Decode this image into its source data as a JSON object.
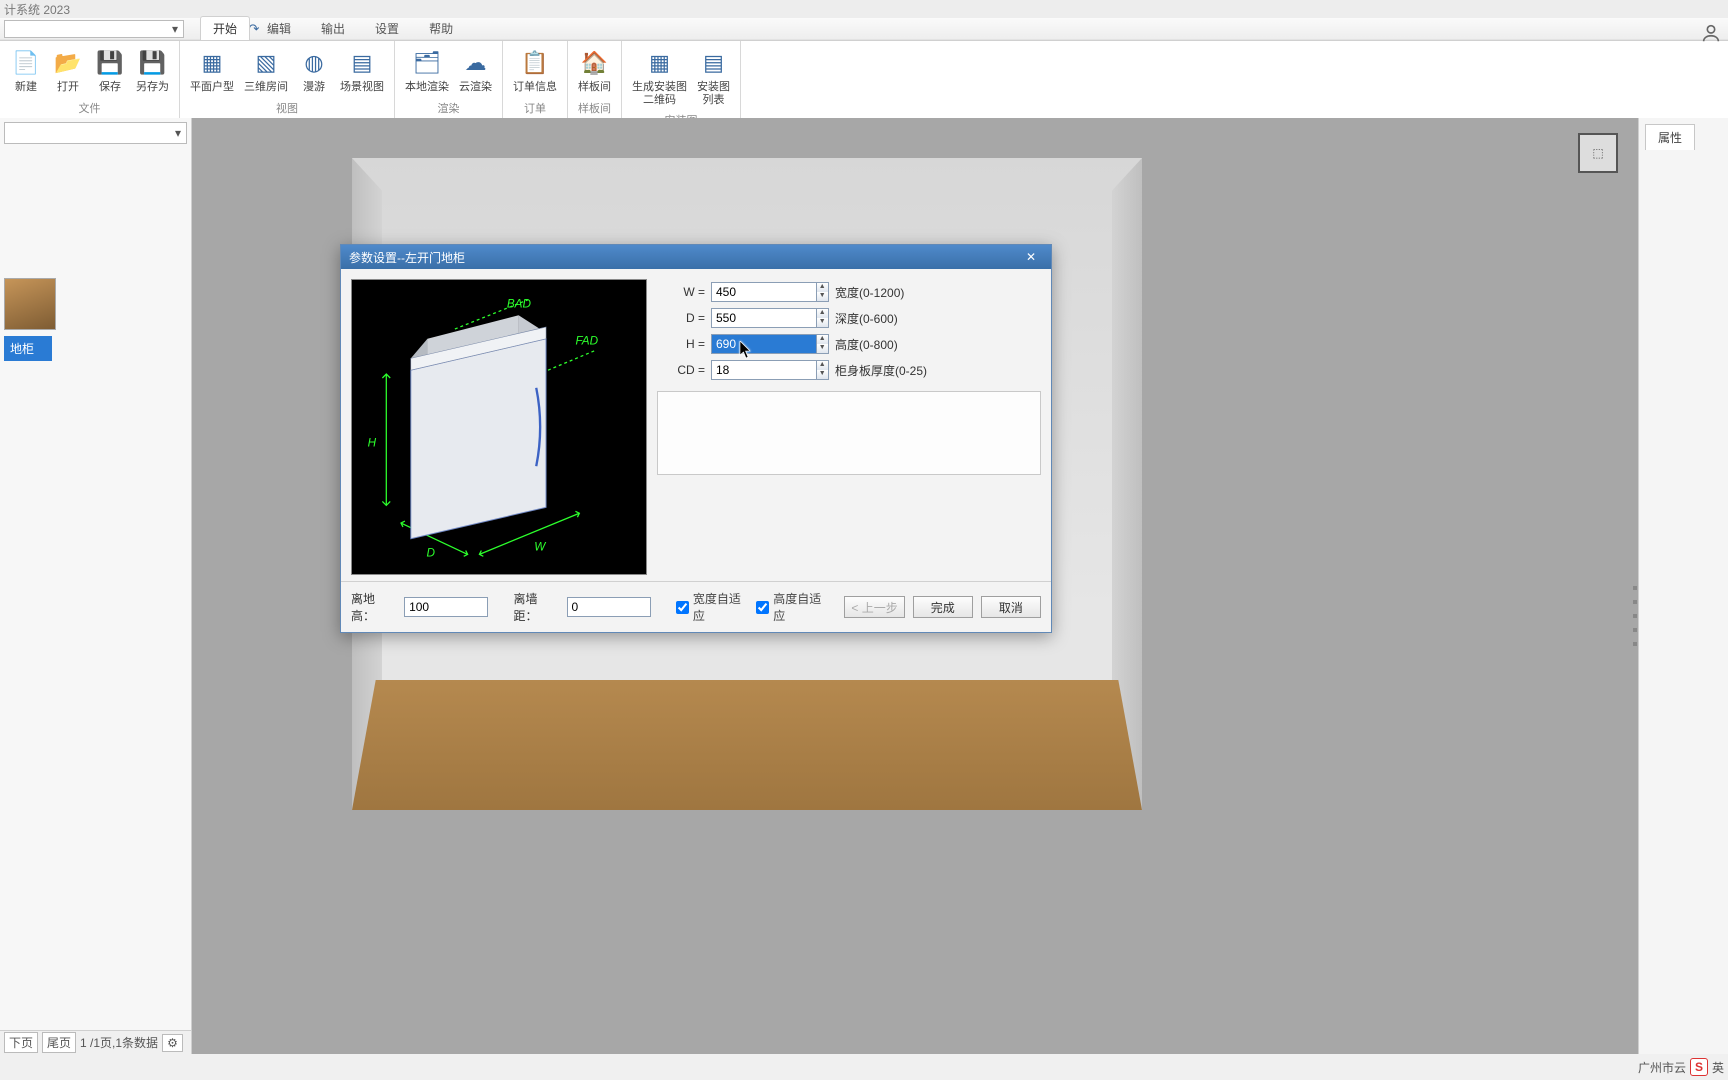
{
  "app": {
    "title": "计系统 2023"
  },
  "ribbon": {
    "tabs": [
      "开始",
      "编辑",
      "输出",
      "设置",
      "帮助"
    ],
    "active_tab": "开始",
    "groups": [
      {
        "label": "文件",
        "buttons": [
          {
            "name": "new",
            "icon": "📄",
            "label": "新建"
          },
          {
            "name": "open",
            "icon": "📂",
            "label": "打开"
          },
          {
            "name": "save",
            "icon": "💾",
            "label": "保存"
          },
          {
            "name": "saveas",
            "icon": "💾",
            "label": "另存为"
          }
        ]
      },
      {
        "label": "视图",
        "buttons": [
          {
            "name": "plan",
            "icon": "▦",
            "label": "平面户型"
          },
          {
            "name": "3droom",
            "icon": "▧",
            "label": "三维房间"
          },
          {
            "name": "roam",
            "icon": "◍",
            "label": "漫游"
          },
          {
            "name": "scene",
            "icon": "▤",
            "label": "场景视图"
          }
        ]
      },
      {
        "label": "渲染",
        "buttons": [
          {
            "name": "localrender",
            "icon": "🗂",
            "label": "本地渲染"
          },
          {
            "name": "cloudrender",
            "icon": "☁",
            "label": "云渲染"
          }
        ]
      },
      {
        "label": "订单",
        "buttons": [
          {
            "name": "orderinfo",
            "icon": "📋",
            "label": "订单信息"
          }
        ]
      },
      {
        "label": "样板间",
        "buttons": [
          {
            "name": "sample",
            "icon": "🏠",
            "label": "样板间"
          }
        ]
      },
      {
        "label": "安装图",
        "buttons": [
          {
            "name": "genqr",
            "icon": "▦",
            "label": "生成安装图\n二维码"
          },
          {
            "name": "installlist",
            "icon": "▤",
            "label": "安装图\n列表"
          }
        ]
      }
    ]
  },
  "left": {
    "selected_name": "地柜",
    "pager": {
      "prev": "下页",
      "last": "尾页",
      "info": "1 /1页,1条数据"
    }
  },
  "right": {
    "tab": "属性"
  },
  "dialog": {
    "title": "参数设置--左开门地柜",
    "params": [
      {
        "key": "W",
        "label": "W  =",
        "value": "450",
        "desc": "宽度(0-1200)",
        "selected": false
      },
      {
        "key": "D",
        "label": "D  =",
        "value": "550",
        "desc": "深度(0-600)",
        "selected": false
      },
      {
        "key": "H",
        "label": "H  =",
        "value": "690",
        "desc": "高度(0-800)",
        "selected": true
      },
      {
        "key": "CD",
        "label": "CD  =",
        "value": "18",
        "desc": "柜身板厚度(0-25)",
        "selected": false
      }
    ],
    "foot": {
      "ground_label": "离地高：",
      "ground_value": "100",
      "wall_label": "离墙距：",
      "wall_value": "0",
      "auto_w": "宽度自适应",
      "auto_h": "高度自适应",
      "prev": "< 上一步",
      "finish": "完成",
      "cancel": "取消"
    },
    "preview_labels": {
      "BAD": "BAD",
      "FAD": "FAD",
      "H": "H",
      "D": "D",
      "W": "W"
    }
  },
  "status": {
    "region": "广州市云",
    "ime": "S",
    "lang": "英"
  }
}
